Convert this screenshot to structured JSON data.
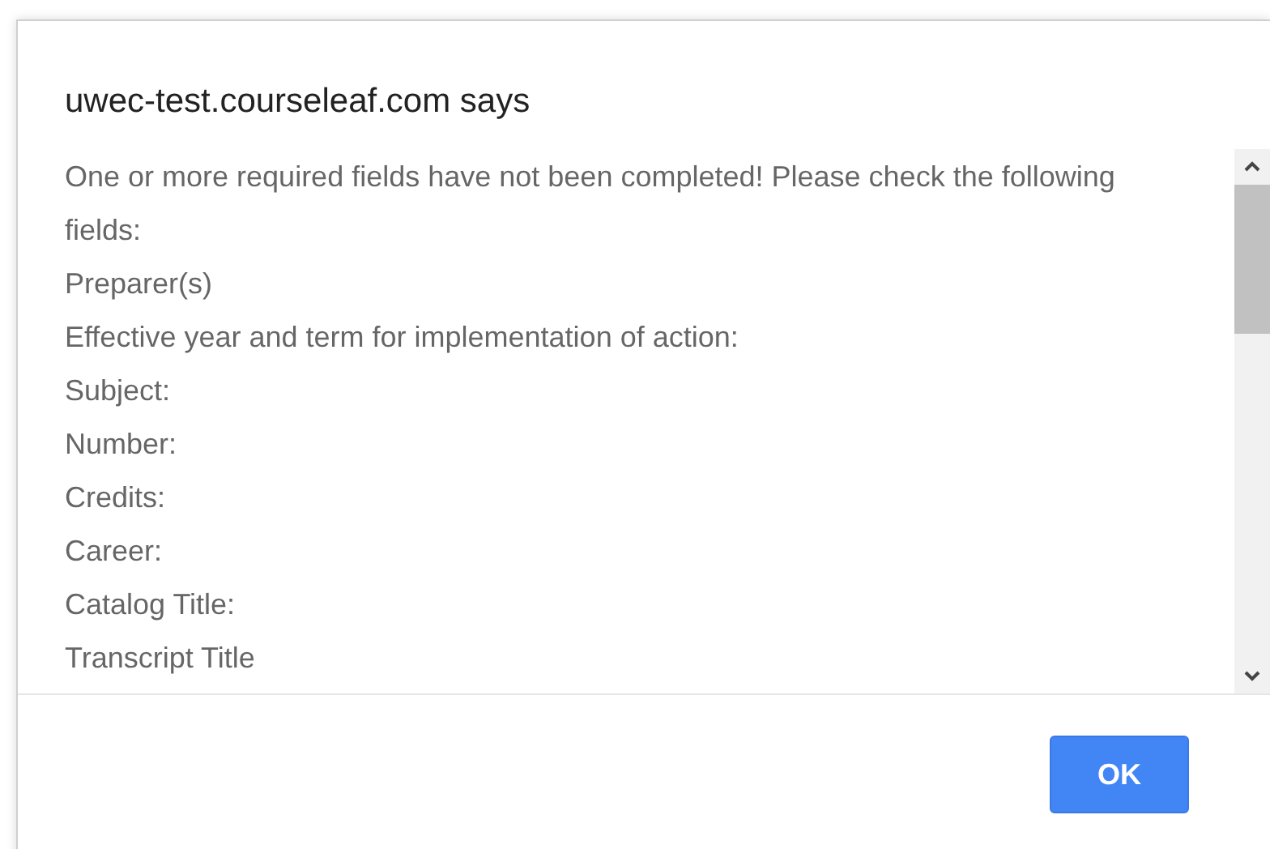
{
  "dialog": {
    "title": "uwec-test.courseleaf.com says",
    "message_lines": [
      "One or more required fields have not been completed! Please check the following fields:",
      "Preparer(s)",
      "Effective year and term for implementation of action:",
      "Subject:",
      "Number:",
      "Credits:",
      "Career:",
      "Catalog Title:",
      "Transcript Title"
    ],
    "buttons": [
      "OK"
    ]
  }
}
